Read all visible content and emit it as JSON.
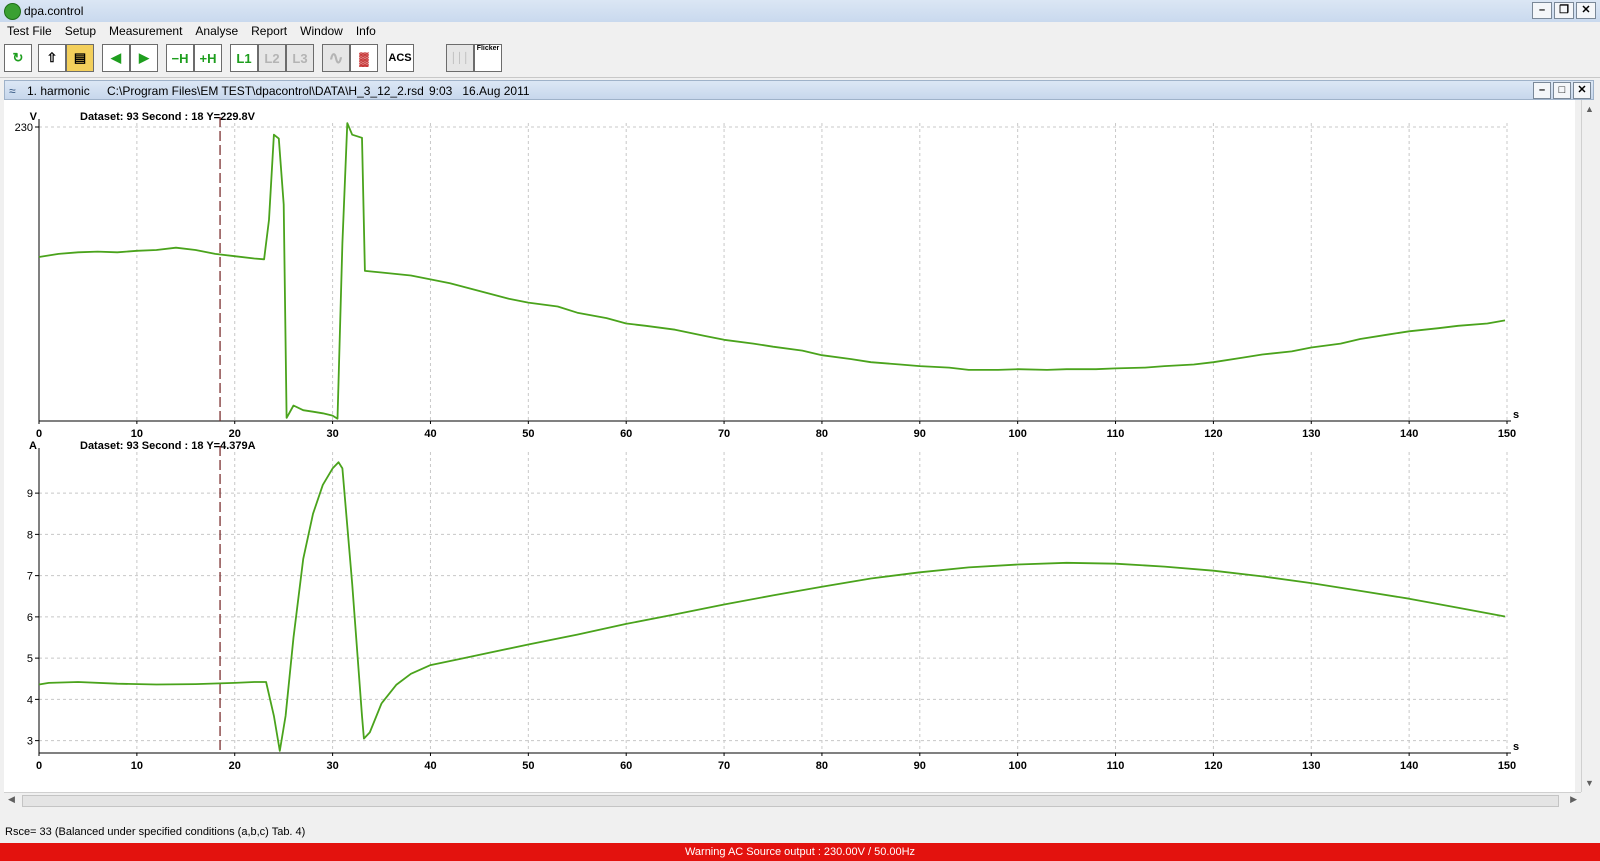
{
  "window": {
    "title": "dpa.control",
    "btn_min": "–",
    "btn_restore": "❐",
    "btn_close": "✕"
  },
  "menu": [
    {
      "label": "Test File"
    },
    {
      "label": "Setup"
    },
    {
      "label": "Measurement"
    },
    {
      "label": "Analyse"
    },
    {
      "label": "Report"
    },
    {
      "label": "Window"
    },
    {
      "label": "Info"
    }
  ],
  "toolbar": {
    "buttons": [
      {
        "name": "refresh-icon",
        "text": "↻",
        "enabled": true
      },
      {
        "name": "export-icon",
        "text": "⇧",
        "enabled": true
      },
      {
        "name": "open-folder-icon",
        "text": "▤",
        "enabled": true
      },
      {
        "name": "arrow-left-icon",
        "text": "◀",
        "enabled": true
      },
      {
        "name": "arrow-right-icon",
        "text": "▶",
        "enabled": true
      },
      {
        "name": "minus-h-button",
        "text": "−H",
        "enabled": true
      },
      {
        "name": "plus-h-button",
        "text": "+H",
        "enabled": true
      },
      {
        "name": "l1-button",
        "text": "L1",
        "enabled": true
      },
      {
        "name": "l2-button",
        "text": "L2",
        "enabled": false
      },
      {
        "name": "l3-button",
        "text": "L3",
        "enabled": false
      },
      {
        "name": "waveform-icon",
        "text": "∿",
        "enabled": false
      },
      {
        "name": "bar-chart-icon",
        "text": "▓",
        "enabled": true
      },
      {
        "name": "acs-button",
        "text": "ACS",
        "enabled": true
      },
      {
        "name": "spectrum-icon",
        "text": "│││",
        "enabled": false
      },
      {
        "name": "flicker-button",
        "text": "Flicker",
        "enabled": true
      }
    ]
  },
  "document": {
    "title": "1. harmonic",
    "path": "C:\\Program Files\\EM TEST\\dpacontrol\\DATA\\H_3_12_2.rsd",
    "time": "9:03",
    "date": "16.Aug 2011"
  },
  "colors": {
    "line": "#4aa31c",
    "cursor": "#7a3030",
    "grid": "#c8c8c8",
    "warning": "#e3120e"
  },
  "chart_data": [
    {
      "type": "line",
      "unit_label": "V",
      "info": "Dataset: 93  Second : 18  Y=229.8V",
      "x_unit": "s",
      "xlim": [
        0,
        150
      ],
      "ylim": [
        192,
        230
      ],
      "y_tick_labels": [
        {
          "value": 230,
          "label": "230"
        }
      ],
      "x_ticks": [
        0,
        10,
        20,
        30,
        40,
        50,
        60,
        70,
        80,
        90,
        100,
        110,
        120,
        130,
        140,
        150
      ],
      "cursor_x": 18.5,
      "points": [
        [
          0,
          213.2
        ],
        [
          2,
          213.6
        ],
        [
          4,
          213.8
        ],
        [
          6,
          213.9
        ],
        [
          8,
          213.8
        ],
        [
          10,
          214.0
        ],
        [
          12,
          214.1
        ],
        [
          14,
          214.4
        ],
        [
          16,
          214.1
        ],
        [
          18,
          213.6
        ],
        [
          20,
          213.3
        ],
        [
          22,
          213.0
        ],
        [
          23,
          212.9
        ],
        [
          23.5,
          218
        ],
        [
          24,
          229.0
        ],
        [
          24.5,
          228.5
        ],
        [
          25,
          220
        ],
        [
          25.3,
          192.4
        ],
        [
          26,
          194.0
        ],
        [
          27,
          193.4
        ],
        [
          28,
          193.2
        ],
        [
          29,
          193.0
        ],
        [
          30,
          192.7
        ],
        [
          30.5,
          192.3
        ],
        [
          31,
          215
        ],
        [
          31.5,
          230.5
        ],
        [
          32,
          229.0
        ],
        [
          33,
          228.6
        ],
        [
          33.3,
          211.4
        ],
        [
          35,
          211.2
        ],
        [
          38,
          210.8
        ],
        [
          40,
          210.3
        ],
        [
          42,
          209.8
        ],
        [
          45,
          208.8
        ],
        [
          48,
          207.8
        ],
        [
          50,
          207.3
        ],
        [
          53,
          206.8
        ],
        [
          55,
          206.0
        ],
        [
          58,
          205.3
        ],
        [
          60,
          204.6
        ],
        [
          62,
          204.3
        ],
        [
          65,
          203.8
        ],
        [
          68,
          203.0
        ],
        [
          70,
          202.5
        ],
        [
          73,
          202.0
        ],
        [
          75,
          201.6
        ],
        [
          78,
          201.1
        ],
        [
          80,
          200.5
        ],
        [
          83,
          200.0
        ],
        [
          85,
          199.6
        ],
        [
          88,
          199.3
        ],
        [
          90,
          199.1
        ],
        [
          93,
          198.9
        ],
        [
          95,
          198.6
        ],
        [
          98,
          198.6
        ],
        [
          100,
          198.7
        ],
        [
          103,
          198.6
        ],
        [
          105,
          198.7
        ],
        [
          108,
          198.7
        ],
        [
          110,
          198.8
        ],
        [
          113,
          198.9
        ],
        [
          115,
          199.1
        ],
        [
          118,
          199.3
        ],
        [
          120,
          199.6
        ],
        [
          123,
          200.2
        ],
        [
          125,
          200.6
        ],
        [
          128,
          201.0
        ],
        [
          130,
          201.5
        ],
        [
          133,
          202.0
        ],
        [
          135,
          202.6
        ],
        [
          138,
          203.2
        ],
        [
          140,
          203.6
        ],
        [
          143,
          204.0
        ],
        [
          145,
          204.3
        ],
        [
          148,
          204.6
        ],
        [
          149.8,
          205.0
        ]
      ]
    },
    {
      "type": "line",
      "unit_label": "A",
      "info": "Dataset: 93  Second : 18  Y=4.379A",
      "x_unit": "s",
      "xlim": [
        0,
        150
      ],
      "ylim": [
        2.7,
        9.9
      ],
      "y_tick_labels": [
        {
          "value": 3,
          "label": "3"
        },
        {
          "value": 4,
          "label": "4"
        },
        {
          "value": 5,
          "label": "5"
        },
        {
          "value": 6,
          "label": "6"
        },
        {
          "value": 7,
          "label": "7"
        },
        {
          "value": 8,
          "label": "8"
        },
        {
          "value": 9,
          "label": "9"
        }
      ],
      "x_ticks": [
        0,
        10,
        20,
        30,
        40,
        50,
        60,
        70,
        80,
        90,
        100,
        110,
        120,
        130,
        140,
        150
      ],
      "cursor_x": 18.5,
      "points": [
        [
          0,
          4.36
        ],
        [
          1,
          4.4
        ],
        [
          4,
          4.42
        ],
        [
          8,
          4.38
        ],
        [
          12,
          4.36
        ],
        [
          16,
          4.37
        ],
        [
          20,
          4.4
        ],
        [
          22,
          4.42
        ],
        [
          23.2,
          4.42
        ],
        [
          24.0,
          3.6
        ],
        [
          24.6,
          2.75
        ],
        [
          25.2,
          3.6
        ],
        [
          26,
          5.5
        ],
        [
          27,
          7.4
        ],
        [
          28,
          8.5
        ],
        [
          29,
          9.2
        ],
        [
          30,
          9.6
        ],
        [
          30.6,
          9.75
        ],
        [
          31,
          9.6
        ],
        [
          32,
          6.8
        ],
        [
          33,
          3.6
        ],
        [
          33.2,
          3.05
        ],
        [
          33.8,
          3.2
        ],
        [
          35,
          3.9
        ],
        [
          36.5,
          4.35
        ],
        [
          38,
          4.62
        ],
        [
          40,
          4.83
        ],
        [
          43,
          4.98
        ],
        [
          46,
          5.13
        ],
        [
          50,
          5.33
        ],
        [
          55,
          5.57
        ],
        [
          60,
          5.83
        ],
        [
          65,
          6.06
        ],
        [
          70,
          6.3
        ],
        [
          75,
          6.52
        ],
        [
          80,
          6.73
        ],
        [
          85,
          6.93
        ],
        [
          90,
          7.08
        ],
        [
          95,
          7.2
        ],
        [
          100,
          7.27
        ],
        [
          105,
          7.31
        ],
        [
          110,
          7.29
        ],
        [
          115,
          7.22
        ],
        [
          120,
          7.12
        ],
        [
          125,
          6.98
        ],
        [
          130,
          6.82
        ],
        [
          135,
          6.63
        ],
        [
          140,
          6.44
        ],
        [
          145,
          6.22
        ],
        [
          149.8,
          6.01
        ]
      ]
    }
  ],
  "status": {
    "rsce": "Rsce= 33 (Balanced under specified conditions (a,b,c) Tab. 4)",
    "warning": "Warning AC Source output : 230.00V / 50.00Hz"
  }
}
